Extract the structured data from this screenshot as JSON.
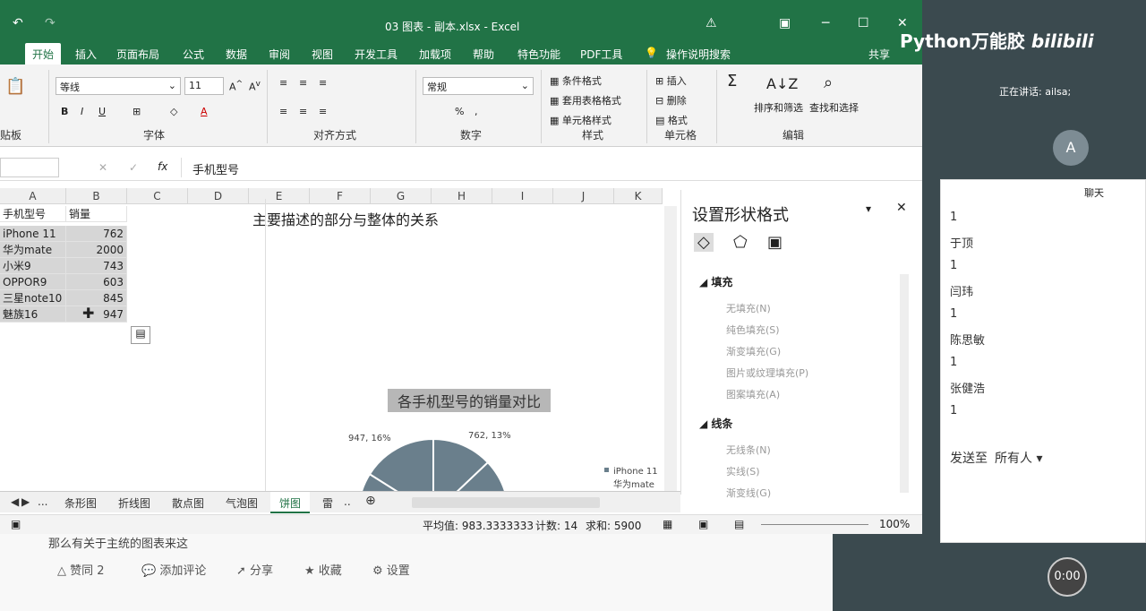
{
  "window": {
    "title": "03 图表 - 副本.xlsx - Excel"
  },
  "ribbon_tabs": [
    "开始",
    "插入",
    "页面布局",
    "公式",
    "数据",
    "审阅",
    "视图",
    "开发工具",
    "加载项",
    "帮助",
    "特色功能",
    "PDF工具",
    "操作说明搜索",
    "共享"
  ],
  "ribbon": {
    "font_name": "等线",
    "font_size": "11",
    "number_format": "常规",
    "groups": [
      "贴板",
      "字体",
      "对齐方式",
      "数字",
      "样式",
      "单元格",
      "编辑"
    ],
    "styles": [
      "条件格式",
      "套用表格格式",
      "单元格样式"
    ],
    "cells": [
      "插入",
      "删除",
      "格式"
    ],
    "editing": [
      "排序和筛选",
      "查找和选择"
    ],
    "bold": "B",
    "italic": "I",
    "underline": "U"
  },
  "formula_bar": {
    "content": "手机型号",
    "fx": "fx"
  },
  "columns": [
    "A",
    "B",
    "C",
    "D",
    "E",
    "F",
    "G",
    "H",
    "I",
    "J",
    "K"
  ],
  "table": {
    "headers": [
      "手机型号",
      "销量"
    ],
    "rows": [
      [
        "iPhone 11",
        "762"
      ],
      [
        "华为mate",
        "2000"
      ],
      [
        "小米9",
        "743"
      ],
      [
        "OPPOR9",
        "603"
      ],
      [
        "三星note10",
        "845"
      ],
      [
        "魅族16",
        "947"
      ]
    ]
  },
  "sheet_text": "主要描述的部分与整体的关系",
  "chart_data": {
    "type": "pie",
    "title": "各手机型号的销量对比",
    "categories": [
      "iPhone 11",
      "华为mate",
      "小米9",
      "OPPOR9",
      "三星note10",
      "魅族16"
    ],
    "values": [
      762,
      2000,
      743,
      603,
      845,
      947
    ],
    "data_labels": [
      "762, 13%",
      "947, 16%"
    ],
    "legend_visible": [
      "iPhone 11",
      "华为mate"
    ],
    "legend": "right"
  },
  "sheet_tabs": [
    "...",
    "条形图",
    "折线图",
    "散点图",
    "气泡图",
    "饼图",
    "雷",
    ".."
  ],
  "status": {
    "average": "平均值: 983.3333333",
    "count": "计数: 14",
    "sum": "求和: 5900",
    "zoom": "100%"
  },
  "format_pane": {
    "title": "设置形状格式",
    "fill_header": "填充",
    "fill_options": [
      "无填充(N)",
      "纯色填充(S)",
      "渐变填充(G)",
      "图片或纹理填充(P)",
      "图案填充(A)"
    ],
    "line_header": "线条",
    "line_options": [
      "无线条(N)",
      "实线(S)",
      "渐变线(G)"
    ]
  },
  "video": {
    "brand": "Python万能胶",
    "site": "bilibili",
    "speaking": "正在讲话: ailsa;",
    "avatar": "A",
    "chat_title": "聊天",
    "chat": [
      [
        "1",
        "于顶"
      ],
      [
        "1",
        "闫玮"
      ],
      [
        "1",
        "陈思敏"
      ],
      [
        "1",
        "张健浩"
      ],
      [
        "1",
        ""
      ]
    ],
    "send_to": "发送至",
    "audience": "所有人",
    "actions": [
      "赞同 2",
      "添加评论",
      "分享",
      "收藏",
      "设置"
    ],
    "timer": "0:00",
    "bottom_text": "那么有关于主统的图表来这"
  }
}
